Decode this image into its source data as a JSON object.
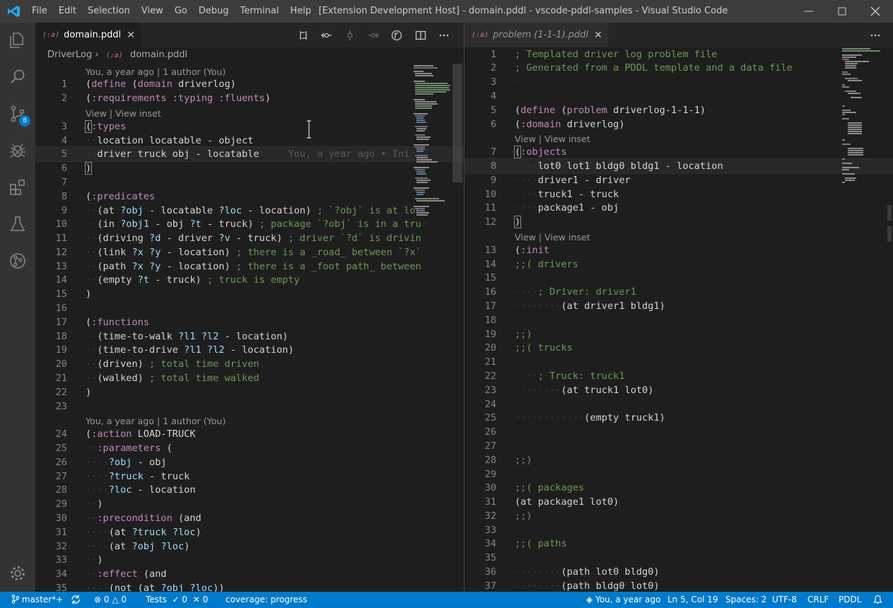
{
  "titlebar": {
    "menu": [
      "File",
      "Edit",
      "Selection",
      "View",
      "Go",
      "Debug",
      "Terminal",
      "Help"
    ],
    "title": "[Extension Development Host] - domain.pddl - vscode-pddl-samples - Visual Studio Code"
  },
  "activity": {
    "items": [
      "files-icon",
      "search-icon",
      "source-control-icon",
      "debug-icon",
      "extensions-icon",
      "test-flask-icon",
      "pddl-planner-icon"
    ],
    "scm_badge": "8"
  },
  "left": {
    "tab_label": "domain.pddl",
    "file_icon": "(:a)",
    "breadcrumb_folder": "DriverLog",
    "breadcrumb_file": "domain.pddl",
    "code_lens_author": "You, a year ago | 1 author (You)",
    "code_lens_view": "View | View inset",
    "blame_inline": "You, a year ago • Ini",
    "code_lens_author2": "You, a year ago | 1 author (You)"
  },
  "right": {
    "tab_label": "problem (1-1-1).pddl",
    "code_lens_view": "View | View inset",
    "code_lens_view2": "View | View inset"
  },
  "status": {
    "branch": "master*+",
    "errors": "0",
    "warnings": "0",
    "tests_label": "Tests",
    "tests_pass": "0",
    "tests_fail": "0",
    "coverage": "coverage: progress",
    "blame": "You, a year ago",
    "position": "Ln 5, Col 19",
    "spaces": "Spaces: 2",
    "encoding": "UTF-8",
    "eol": "CRLF",
    "language": "PDDL"
  },
  "colors": {
    "accent": "#007acc",
    "keyword": "#c586c0",
    "variable": "#9cdcfe",
    "comment": "#6a9955"
  }
}
